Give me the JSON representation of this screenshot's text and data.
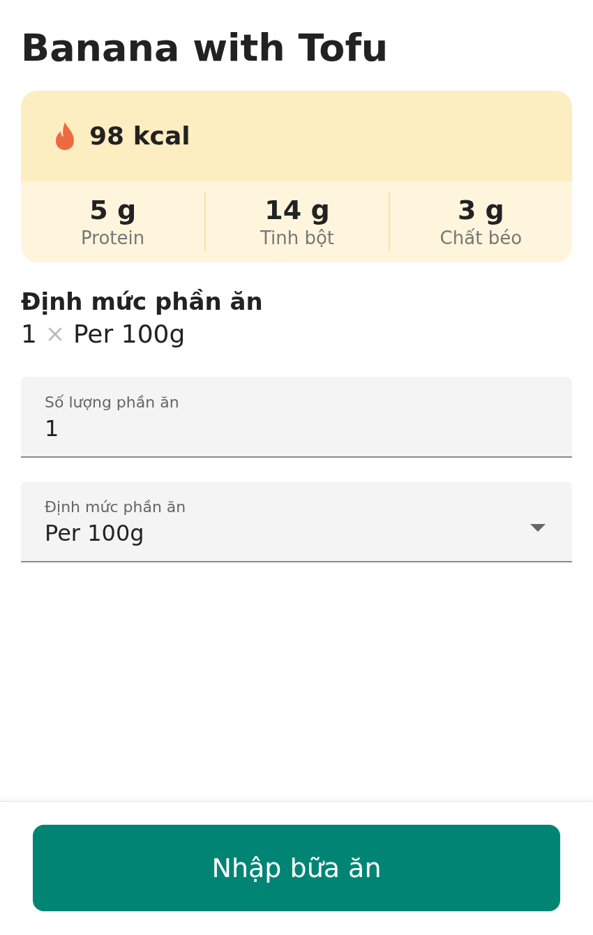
{
  "title": "Banana with Tofu",
  "calories": "98 kcal",
  "macros": [
    {
      "value": "5 g",
      "label": "Protein"
    },
    {
      "value": "14 g",
      "label": "Tinh bột"
    },
    {
      "value": "3 g",
      "label": "Chất béo"
    }
  ],
  "serving": {
    "heading": "Định mức phần ăn",
    "count": "1",
    "unit": "Per 100g"
  },
  "fields": [
    {
      "kind": "input",
      "label": "Số lượng phần ăn",
      "value": "1"
    },
    {
      "kind": "select",
      "label": "Định mức phần ăn",
      "value": "Per 100g"
    }
  ],
  "submit_button": "Nhập bữa ăn"
}
